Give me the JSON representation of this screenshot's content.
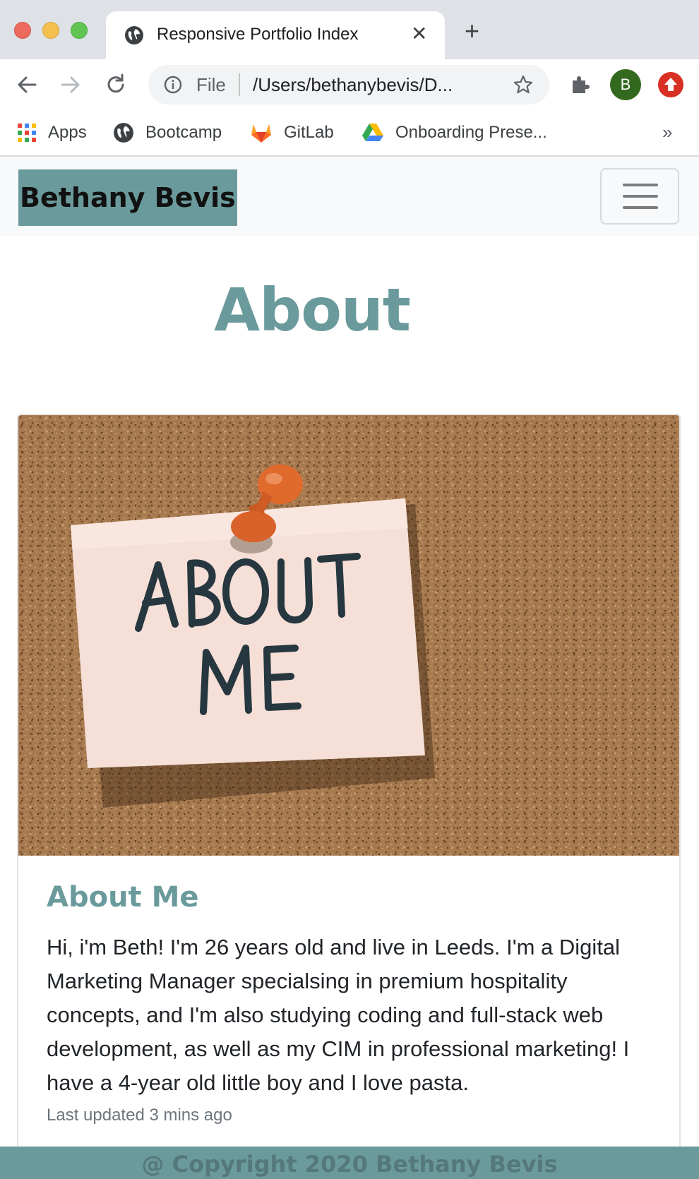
{
  "browser": {
    "tab_title": "Responsive Portfolio Index",
    "new_tab_symbol": "+",
    "close_symbol": "✕",
    "url_scheme_label": "File",
    "url": "/Users/bethanybevis/D...",
    "profile_initial": "B",
    "bookmarks": [
      {
        "label": "Apps",
        "icon": "apps-grid-icon"
      },
      {
        "label": "Bootcamp",
        "icon": "globe-icon"
      },
      {
        "label": "GitLab",
        "icon": "gitlab-icon"
      },
      {
        "label": "Onboarding Prese...",
        "icon": "google-drive-icon"
      }
    ],
    "bookmarks_more": "»",
    "colors": {
      "tab_strip": "#dee1e6",
      "omnibox": "#f1f3f4",
      "profile": "#33691e",
      "update": "#d93025"
    }
  },
  "navbar": {
    "brand": "Bethany Bevis",
    "toggler_icon": "hamburger-menu-icon"
  },
  "main": {
    "heading": "About",
    "card": {
      "image_note_text": "ABOUT ME",
      "title": "About Me",
      "text": "Hi, i'm Beth! I'm 26 years old and live in Leeds. I'm a Digital Marketing Manager specialsing in premium hospitality concepts, and I'm also studying coding and full-stack web development, as well as my CIM in professional marketing! I have a 4-year old little boy and I love pasta.",
      "updated": "Last updated 3 mins ago"
    }
  },
  "footer": {
    "text": "@ Copyright 2020 Bethany Bevis"
  },
  "theme": {
    "accent": "#6b9a9c",
    "navbar_bg": "#f8f9fa",
    "footer_text": "#55787a"
  }
}
